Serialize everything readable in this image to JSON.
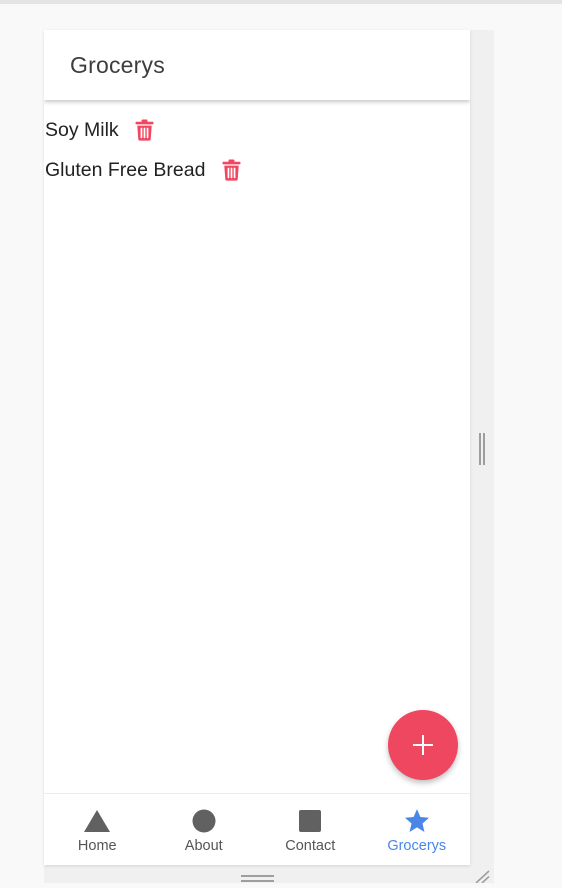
{
  "app_bar": {
    "title": "Grocerys"
  },
  "groceries": [
    {
      "label": "Soy Milk",
      "action_icon": "trash-icon"
    },
    {
      "label": "Gluten Free Bread",
      "action_icon": "trash-icon"
    }
  ],
  "fab": {
    "icon": "plus-icon"
  },
  "bottom_nav": {
    "items": [
      {
        "label": "Home",
        "icon": "triangle-icon",
        "active": false
      },
      {
        "label": "About",
        "icon": "circle-icon",
        "active": false
      },
      {
        "label": "Contact",
        "icon": "square-icon",
        "active": false
      },
      {
        "label": "Grocerys",
        "icon": "star-icon",
        "active": true
      }
    ]
  },
  "colors": {
    "accent_red": "#ef4760",
    "active_blue": "#4a86e8",
    "icon_gray": "#616161",
    "text_dark": "#222222"
  }
}
